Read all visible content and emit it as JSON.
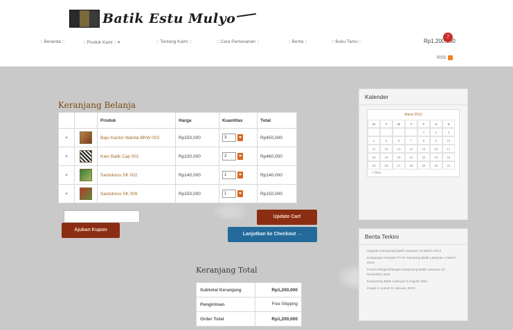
{
  "header": {
    "logo_text": "Batik Estu Mulyo",
    "nav": [
      {
        "label": ":: Beranda ::"
      },
      {
        "label": ":: Produk Kami :: ▾"
      },
      {
        "label": ":: Tentang Kami ::"
      },
      {
        "label": ":: Cara Pemesanan ::"
      },
      {
        "label": ":: Berita ::"
      },
      {
        "label": ":: Buku Tamu ::"
      }
    ],
    "cart_total": "Rp1,200,000",
    "cart_count": "7",
    "rss_label": "RSS"
  },
  "cart": {
    "title": "Keranjang Belanja",
    "columns": [
      "Produk",
      "Harga",
      "Kuantitas",
      "Total"
    ],
    "remove_symbol": "×",
    "rows": [
      {
        "name": "Baju Kantor Wanita BKW 003",
        "price": "Rp150,000",
        "qty": "3",
        "total": "Rp450,000"
      },
      {
        "name": "Kain Batik Cap 001",
        "price": "Rp230,000",
        "qty": "2",
        "total": "Rp460,000"
      },
      {
        "name": "Sackdress SK 002",
        "price": "Rp140,000",
        "qty": "1",
        "total": "Rp140,000"
      },
      {
        "name": "Sackdress SK 009",
        "price": "Rp150,000",
        "qty": "1",
        "total": "Rp150,000"
      }
    ],
    "coupon_placeholder": "",
    "coupon_button": "Ajukan Kupon",
    "update_button": "Update Cart",
    "checkout_button": "Lanjutkan ke Checkout →"
  },
  "totals": {
    "title": "Keranjang Total",
    "rows": [
      {
        "label": "Subtotal Keranjang",
        "value": "Rp1,200,000"
      },
      {
        "label": "Pengiriman",
        "value": "Free Shipping"
      },
      {
        "label": "Order Total",
        "value": "Rp1,200,000"
      }
    ]
  },
  "sidebar": {
    "calendar": {
      "title": "Kalender",
      "caption": "Maret 2013",
      "weekdays": [
        "M",
        "T",
        "W",
        "T",
        "F",
        "S",
        "S"
      ],
      "weeks": [
        [
          "",
          "",
          "",
          "",
          "1",
          "2",
          "3"
        ],
        [
          "4",
          "5",
          "6",
          "7",
          "8",
          "9",
          "10"
        ],
        [
          "11",
          "12",
          "13",
          "14",
          "15",
          "16",
          "17"
        ],
        [
          "18",
          "19",
          "20",
          "21",
          "22",
          "23",
          "24"
        ],
        [
          "25",
          "26",
          "27",
          "28",
          "29",
          "30",
          "31"
        ]
      ],
      "prev_link": "« Nov"
    },
    "news": {
      "title": "Berita Terkini",
      "items": [
        "Sejarah Kampoeng Batik Laweyan 13 March 2013",
        "Kunjungan Kompas TV ke Kampung Batik Laweyan 4 March 2013",
        "Forum Pengembangan Kampoeng Batik Laweyan 22 November 2011",
        "Kampoeng Batik Laweyan 5 August 2011",
        "Image in a post 11 January 2010"
      ]
    }
  },
  "colors": {
    "accent_brown": "#8a2d12",
    "checkout_blue": "#236a9a",
    "badge_red": "#c9302c",
    "spinner_orange": "#d86a20"
  }
}
